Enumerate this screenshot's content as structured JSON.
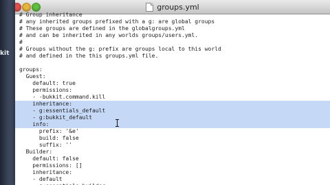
{
  "desktop": {
    "partial_label": "kit"
  },
  "window": {
    "title": "groups.yml",
    "icon": "document-icon"
  },
  "editor": {
    "lines": [
      {
        "text": "# Group inheritance",
        "selected": false
      },
      {
        "text": "# any inherited groups prefixed with a g: are global groups",
        "selected": false
      },
      {
        "text": "# These groups are defined in the globalgroups.yml",
        "selected": false
      },
      {
        "text": "# and can be inherited in any worlds groups/users.yml.",
        "selected": false
      },
      {
        "text": "#",
        "selected": false
      },
      {
        "text": "# Groups without the g: prefix are groups local to this world",
        "selected": false
      },
      {
        "text": "# and defined in the this groups.yml file.",
        "selected": false
      },
      {
        "text": "",
        "selected": false
      },
      {
        "text": "groups:",
        "selected": false
      },
      {
        "text": "  Guest:",
        "selected": false
      },
      {
        "text": "    default: true",
        "selected": false
      },
      {
        "text": "    permissions:",
        "selected": false
      },
      {
        "text": "    - -bukkit.command.kill",
        "selected": false
      },
      {
        "text": "    inheritance:",
        "selected": true
      },
      {
        "text": "    - g:essentials_default",
        "selected": true
      },
      {
        "text": "    - g:bukkit_default",
        "selected": true
      },
      {
        "text": "    info:",
        "selected": true
      },
      {
        "text": "      prefix: '&e'",
        "selected": false
      },
      {
        "text": "      build: false",
        "selected": false
      },
      {
        "text": "      suffix: ''",
        "selected": false
      },
      {
        "text": "  Builder:",
        "selected": false
      },
      {
        "text": "    default: false",
        "selected": false
      },
      {
        "text": "    permissions: []",
        "selected": false
      },
      {
        "text": "    inheritance:",
        "selected": false
      },
      {
        "text": "    - default",
        "selected": false
      },
      {
        "text": "    - g:essentials_builder",
        "selected": false
      }
    ]
  },
  "colors": {
    "selection": "#c5d8f6",
    "close": "#e0514a",
    "minimize": "#e6b53b",
    "maximize": "#5fbf3c"
  }
}
